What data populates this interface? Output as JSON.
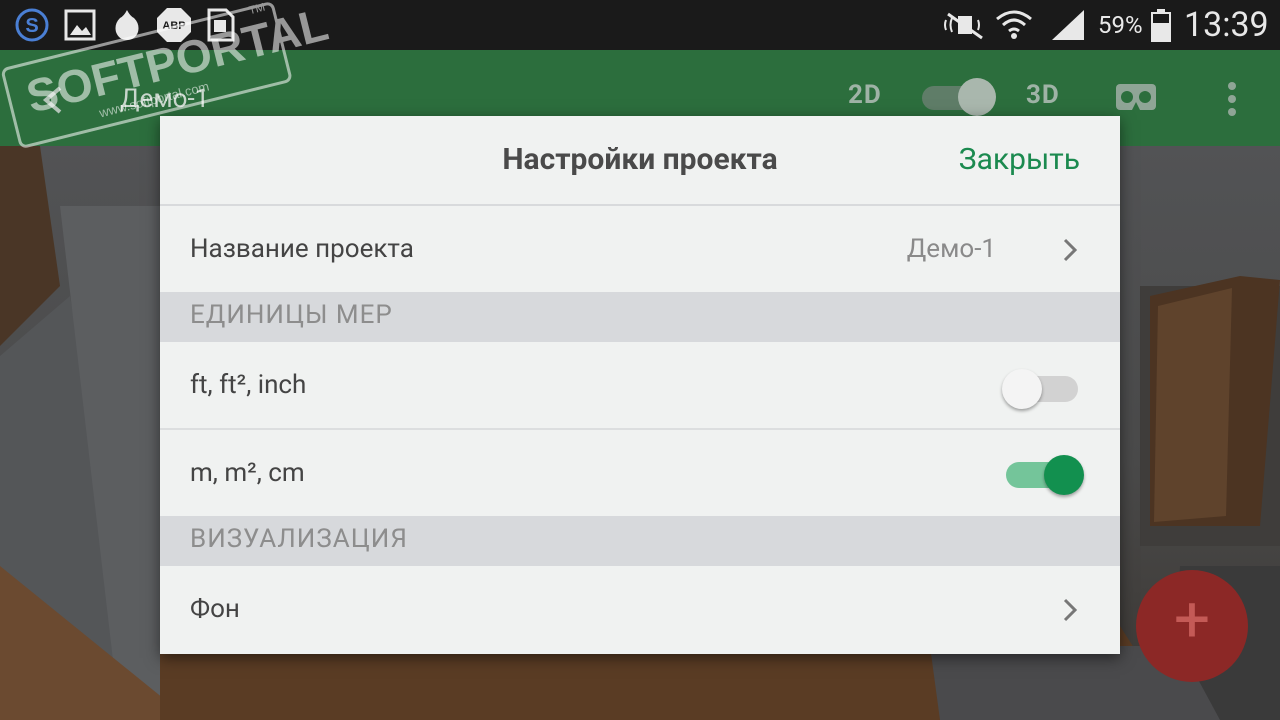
{
  "status_bar": {
    "battery_percent": "59%",
    "time": "13:39",
    "abp_label": "ABP",
    "icons": [
      "s-app-icon",
      "gallery-icon",
      "onion-icon",
      "adblock-icon",
      "sim-icon",
      "mute-icon",
      "wifi-icon",
      "signal-icon",
      "battery-icon"
    ]
  },
  "app_bar": {
    "title": "Демо-1",
    "mode_2d": "2D",
    "mode_3d": "3D",
    "icons": [
      "back-arrow-icon",
      "vr-headset-icon",
      "more-vert-icon"
    ]
  },
  "watermark": {
    "main": "SOFTPORTAL",
    "sub": "www.softportal.com",
    "tm": "TM"
  },
  "dialog": {
    "title": "Настройки проекта",
    "close_label": "Закрыть",
    "project_name_label": "Название проекта",
    "project_name_value": "Демо-1",
    "units_section": "ЕДИНИЦЫ МЕР",
    "unit_imperial": "ft, ft², inch",
    "unit_metric": "m, m², cm",
    "imperial_enabled": false,
    "metric_enabled": true,
    "visual_section": "ВИЗУАЛИЗАЦИЯ",
    "background_label": "Фон"
  },
  "fab": {
    "label": "+"
  },
  "colors": {
    "accent_green": "#1b8a4f",
    "toolbar_green": "#2c6e3d",
    "switch_on_thumb": "#12904f",
    "switch_on_track": "#74c59a",
    "fab": "#8c2826"
  }
}
